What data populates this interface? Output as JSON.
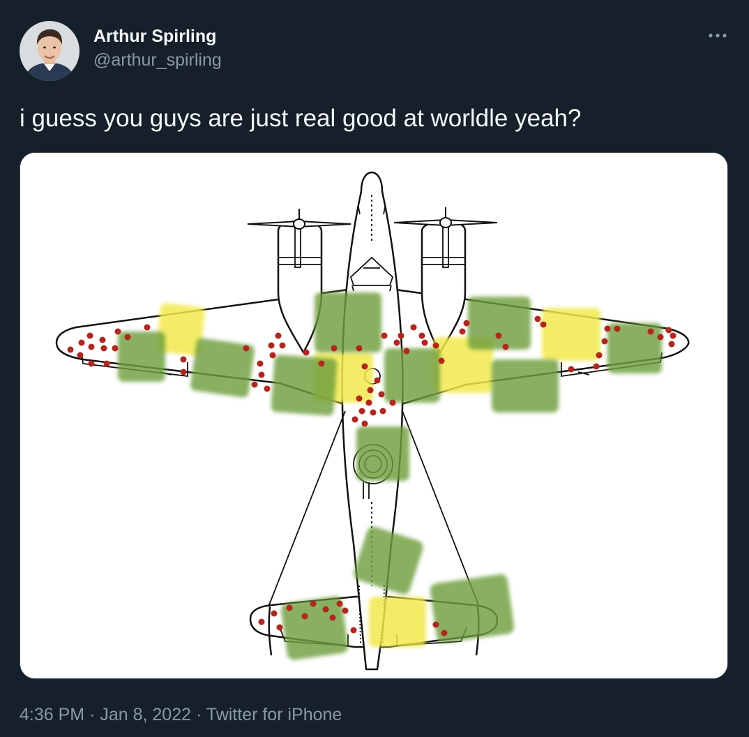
{
  "tweet": {
    "author": {
      "display_name": "Arthur Spirling",
      "handle": "@arthur_spirling"
    },
    "text": "i guess you guys are just real good at worldle yeah?",
    "time": "4:36 PM",
    "date": "Jan 8, 2022",
    "source": "Twitter for iPhone",
    "separator": "·"
  },
  "icons": {
    "more": "more-horizontal-icon",
    "avatar": "profile-photo"
  },
  "colors": {
    "background": "#15202b",
    "primary_text": "#f7f9f9",
    "secondary_text": "#8b98a5",
    "hit_marker": "#b5251d",
    "green_patch": "#6e9f3c",
    "yellow_patch": "#f2e94b"
  }
}
